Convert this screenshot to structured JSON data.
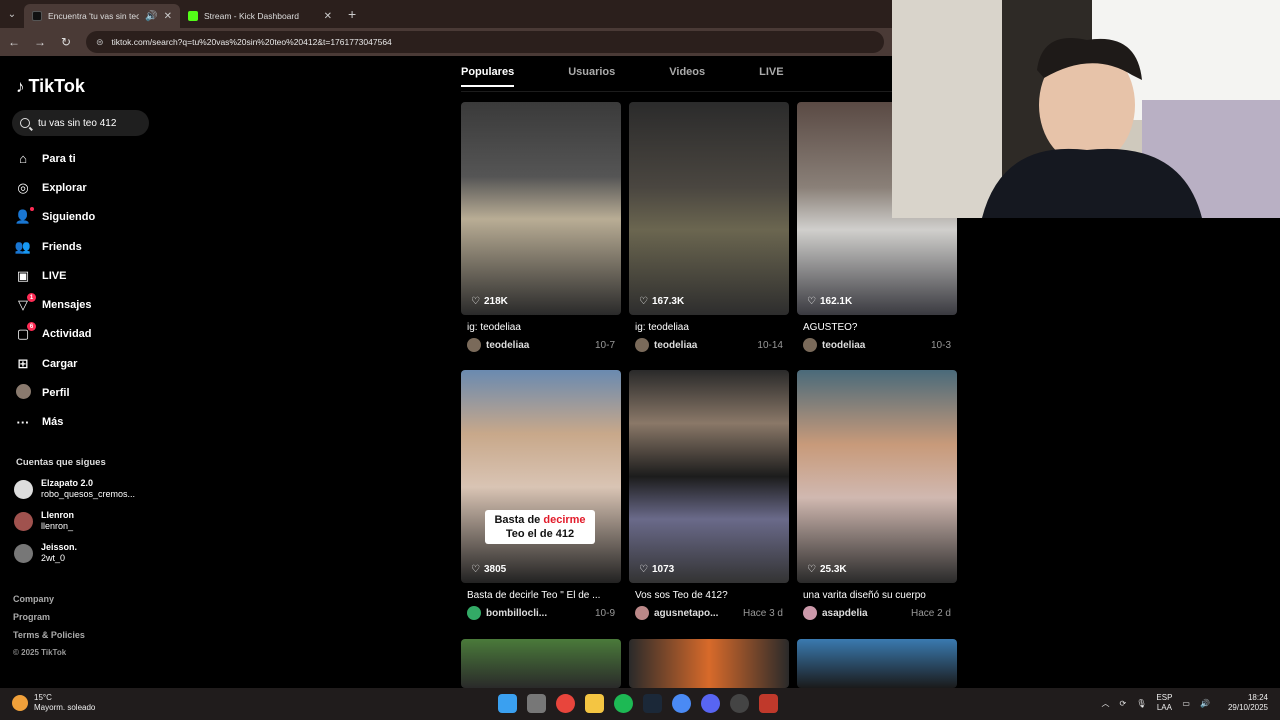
{
  "browser": {
    "tabs": [
      {
        "title": "Encuentra 'tu vas sin teo 41",
        "active": true
      },
      {
        "title": "Stream - Kick Dashboard",
        "active": false
      }
    ],
    "url": "tiktok.com/search?q=tu%20vas%20sin%20teo%20412&t=1761773047564"
  },
  "sidebar": {
    "logo": "TikTok",
    "search_value": "tu vas sin teo 412",
    "menu": [
      {
        "label": "Para ti",
        "icon": "home-icon"
      },
      {
        "label": "Explorar",
        "icon": "compass-icon"
      },
      {
        "label": "Siguiendo",
        "icon": "following-icon"
      },
      {
        "label": "Friends",
        "icon": "friends-icon"
      },
      {
        "label": "LIVE",
        "icon": "live-icon"
      },
      {
        "label": "Mensajes",
        "icon": "messages-icon",
        "badge": "1"
      },
      {
        "label": "Actividad",
        "icon": "activity-icon",
        "badge": "6"
      },
      {
        "label": "Cargar",
        "icon": "upload-icon"
      },
      {
        "label": "Perfil",
        "icon": "profile-avatar"
      },
      {
        "label": "Más",
        "icon": "more-icon"
      }
    ],
    "follows_title": "Cuentas que sigues",
    "follows": [
      {
        "name": "Elzapato 2.0",
        "handle": "robo_quesos_cremos..."
      },
      {
        "name": "Llenron",
        "handle": "llenron_"
      },
      {
        "name": "Jeisson.",
        "handle": "2wt_0"
      }
    ],
    "footer": [
      "Company",
      "Program",
      "Terms & Policies",
      "© 2025 TikTok"
    ]
  },
  "tabs": [
    "Populares",
    "Usuarios",
    "Videos",
    "LIVE"
  ],
  "videos": [
    {
      "likes": "218K",
      "desc": "ig: teodeliaa",
      "user": "teodeliaa",
      "date": "10-7"
    },
    {
      "likes": "167.3K",
      "desc": "ig: teodeliaa",
      "user": "teodeliaa",
      "date": "10-14"
    },
    {
      "likes": "162.1K",
      "desc": "AGUSTEO?",
      "user": "teodeliaa",
      "date": "10-3"
    },
    {
      "likes": "3805",
      "desc": "Basta de decirle Teo \" El de ...",
      "user": "bombillocli...",
      "date": "10-9",
      "overlay_1": "Basta de ",
      "overlay_red": "decirme",
      "overlay_2": "Teo el de 412"
    },
    {
      "likes": "1073",
      "desc": "Vos sos Teo de 412?",
      "user": "agusnetapo...",
      "date": "Hace 3 d"
    },
    {
      "likes": "25.3K",
      "desc": "una varita diseñó su cuerpo",
      "user": "asapdelia",
      "date": "Hace 2 d"
    }
  ],
  "taskbar": {
    "temp": "15°C",
    "weather": "Mayorm. soleado",
    "lang1": "ESP",
    "lang2": "LAA",
    "time": "18:24",
    "date": "29/10/2025"
  }
}
